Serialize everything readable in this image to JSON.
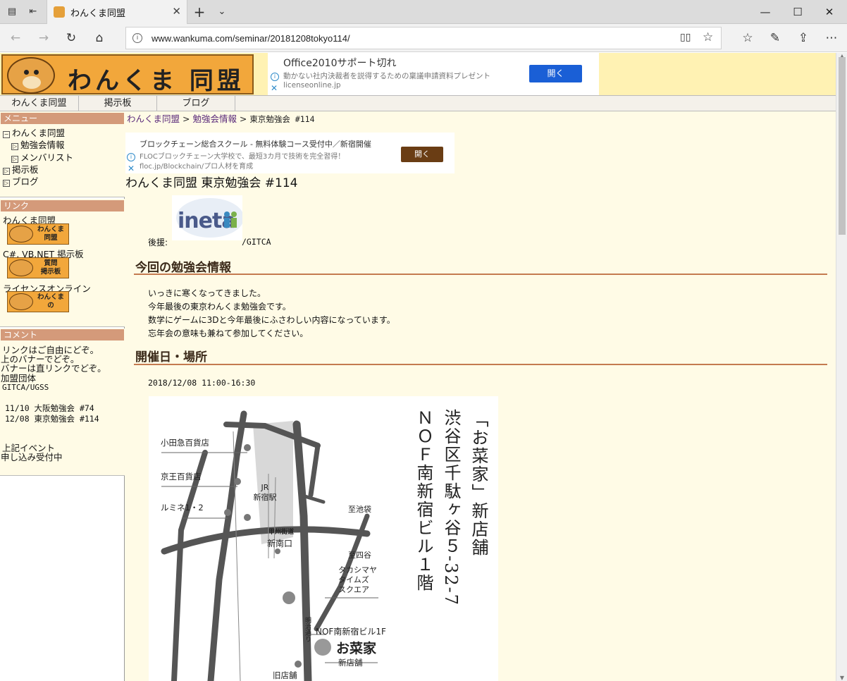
{
  "browser": {
    "tab_title": "わんくま同盟",
    "url": "www.wankuma.com/seminar/20181208tokyo114/"
  },
  "site": {
    "logo_text": "わんくま 同盟",
    "ad_top": {
      "title": "Office2010サポート切れ",
      "desc": "動かない社内決裁者を説得するための稟議申請資料プレゼント",
      "domain": "licenseonline.jp",
      "button": "開く"
    },
    "menu": [
      "わんくま同盟",
      "掲示板",
      "ブログ"
    ]
  },
  "sidebar": {
    "menu_header": "メニュー",
    "menu_items": [
      "わんくま同盟",
      "勉強会情報",
      "メンバリスト",
      "掲示板",
      "ブログ"
    ],
    "link_header": "リンク",
    "links": [
      {
        "label": "わんくま同盟",
        "banner": [
          "わんくま",
          "同盟"
        ]
      },
      {
        "label": "C#, VB.NET 掲示板",
        "banner": [
          "質問",
          "掲示板"
        ]
      },
      {
        "label": "ライセンスオンライン",
        "banner": [
          "わんくま",
          "の"
        ]
      }
    ],
    "comment_header": "コメント",
    "comments": [
      "リンクはご自由にどぞ。",
      "上のバナーでどぞ。",
      "バナーは直リンクでどぞ。",
      "加盟団体",
      "GITCA/UGSS",
      "11/10 大阪勉強会 #74",
      "12/08 東京勉強会 #114",
      "上記イベント",
      "申し込み受付中"
    ]
  },
  "breadcrumb": {
    "home": "わんくま同盟",
    "sep": " > ",
    "section": "勉強会情報",
    "current": "東京勉強会 #114"
  },
  "ad_inline": {
    "title": "ブロックチェーン総合スクール - 無料体験コース受付中／新宿開催",
    "desc": "FLOCブロックチェーン大学校で、最短3カ月で技術を完全習得！",
    "domain": "floc.jp/Blockchain/プロ人材を育成",
    "button": "開く"
  },
  "main": {
    "title": "わんくま同盟 東京勉強会 #114",
    "sponsor_label": "後援:",
    "sponsor_suffix": "/GITCA",
    "ineta_logo": "ineta",
    "section1": "今回の勉強会情報",
    "intro": [
      "いっきに寒くなってきました。",
      "今年最後の東京わんくま勉強会です。",
      "数学にゲームに3Dと今年最後にふさわしい内容になっています。",
      "忘年会の意味も兼ねて参加してください。"
    ],
    "section2": "開催日・場所",
    "datetime": "2018/12/08 11:00-16:30"
  },
  "map": {
    "stores": [
      "小田急百貨店",
      "京王百貨店",
      "ルミネ1・2"
    ],
    "station": "JR\n新宿駅",
    "koshu": "甲州街道",
    "shinminami": "新南口",
    "ikebukuro": "至池袋",
    "yotsuya": "至四谷",
    "takashimaya": "タカシマヤ\nタイムズ\nスクエア",
    "meiji": "明治通り",
    "nof": "NOF南新宿ビル1F",
    "shop_logo": "お菜家",
    "newshop": "新店舗",
    "oldshop": "旧店舗",
    "address": [
      "「お菜家」新店舗",
      "渋谷区千駄ヶ谷５-32-7",
      "ＮＯＦ南新宿ビル１階"
    ]
  }
}
